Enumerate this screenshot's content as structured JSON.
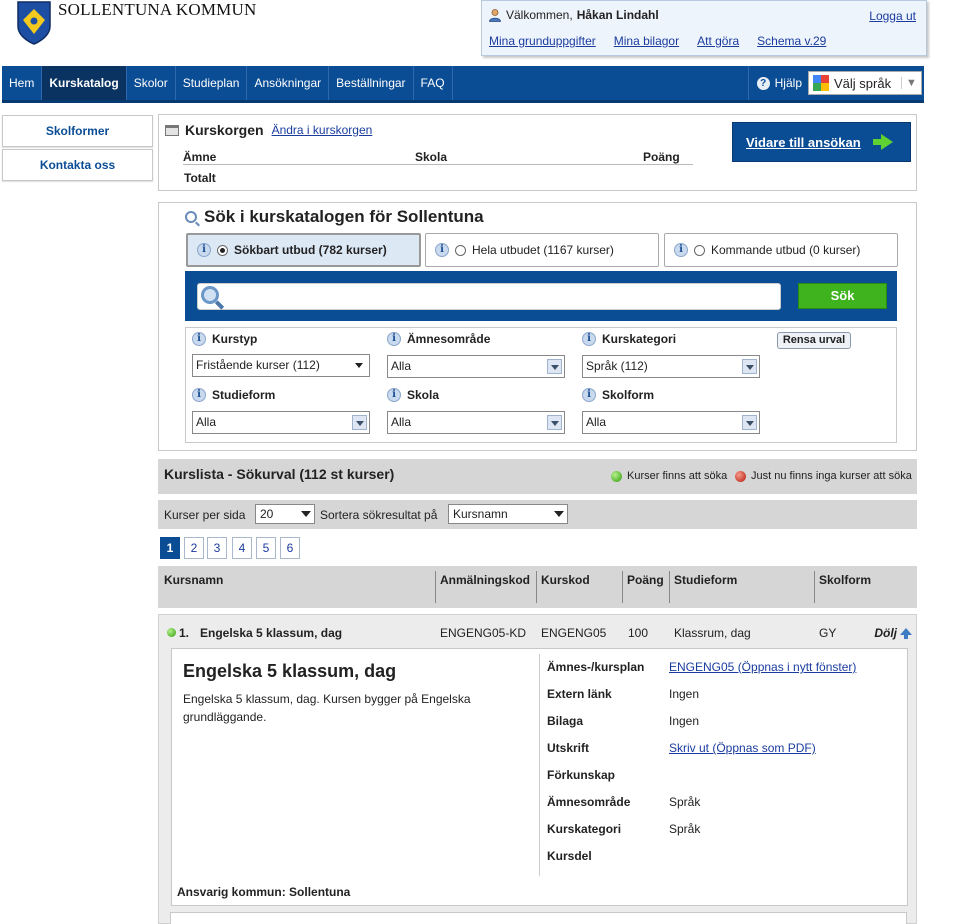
{
  "header": {
    "brand": "SOLLENTUNA KOMMUN",
    "welcome_prefix": "Välkommen,",
    "user_name": "Håkan Lindahl",
    "logout": "Logga ut",
    "links": [
      "Mina grunduppgifter",
      "Mina bilagor",
      "Att göra",
      "Schema v.29"
    ]
  },
  "nav": {
    "items": [
      "Hem",
      "Kurskatalog",
      "Skolor",
      "Studieplan",
      "Ansökningar",
      "Beställningar",
      "FAQ"
    ],
    "active": "Kurskatalog",
    "help": "Hjälp",
    "language": "Välj språk",
    "accent_color": "#0b4d95"
  },
  "sidebar": {
    "items": [
      "Skolformer",
      "Kontakta oss"
    ]
  },
  "kurskorg": {
    "title": "Kurskorgen",
    "edit_link": "Ändra i kurskorgen",
    "col_amne": "Ämne",
    "col_skola": "Skola",
    "col_poang": "Poäng",
    "total": "Totalt",
    "continue_button": "Vidare till ansökan"
  },
  "search": {
    "title": "Sök i kurskatalogen för Sollentuna",
    "options": [
      "Sökbart utbud (782 kurser)",
      "Hela utbudet (1167 kurser)",
      "Kommande utbud (0 kurser)"
    ],
    "selected_option": "Sökbart utbud (782 kurser)",
    "query": "",
    "search_button": "Sök",
    "clear_button": "Rensa urval",
    "filters": {
      "kurstyp_label": "Kurstyp",
      "kurstyp_value": "Fristående kurser (112)",
      "amnesomrade_label": "Ämnesområde",
      "amnesomrade_value": "Alla",
      "kurskategori_label": "Kurskategori",
      "kurskategori_value": "Språk (112)",
      "studieform_label": "Studieform",
      "studieform_value": "Alla",
      "skola_label": "Skola",
      "skola_value": "Alla",
      "skolform_label": "Skolform",
      "skolform_value": "Alla"
    }
  },
  "list": {
    "title": "Kurslista - Sökurval (112 st kurser)",
    "legend_available": "Kurser finns att söka",
    "legend_unavailable": "Just nu finns inga kurser att söka",
    "per_page_label": "Kurser per sida",
    "per_page_value": "20",
    "sort_label": "Sortera sökresultat på",
    "sort_value": "Kursnamn",
    "pages": [
      "1",
      "2",
      "3",
      "4",
      "5",
      "6"
    ],
    "current_page": "1",
    "columns": [
      "Kursnamn",
      "Anmälningskod",
      "Kurskod",
      "Poäng",
      "Studieform",
      "Skolform"
    ]
  },
  "course": {
    "number": "1.",
    "name": "Engelska 5 klassum, dag",
    "anmalningskod": "ENGENG05-KD",
    "kurskod": "ENGENG05",
    "poang": "100",
    "studieform": "Klassrum, dag",
    "skolform": "GY",
    "hide_label": "Dölj",
    "title": "Engelska 5 klassum, dag",
    "description": "Engelska 5 klassum, dag. Kursen bygger på Engelska grundläggande.",
    "details": {
      "amnesplan_label": "Ämnes-/kursplan",
      "amnesplan_value": "ENGENG05 (Öppnas i nytt fönster)",
      "extern_label": "Extern länk",
      "extern_value": "Ingen",
      "bilaga_label": "Bilaga",
      "bilaga_value": "Ingen",
      "utskrift_label": "Utskrift",
      "utskrift_value": "Skriv ut (Öppnas som PDF)",
      "forkunskap_label": "Förkunskap",
      "amnesomrade_label": "Ämnesområde",
      "amnesomrade_value": "Språk",
      "kurskategori_label": "Kurskategori",
      "kurskategori_value": "Språk",
      "kursdel_label": "Kursdel"
    },
    "ansvarig": "Ansvarig kommun: Sollentuna"
  }
}
